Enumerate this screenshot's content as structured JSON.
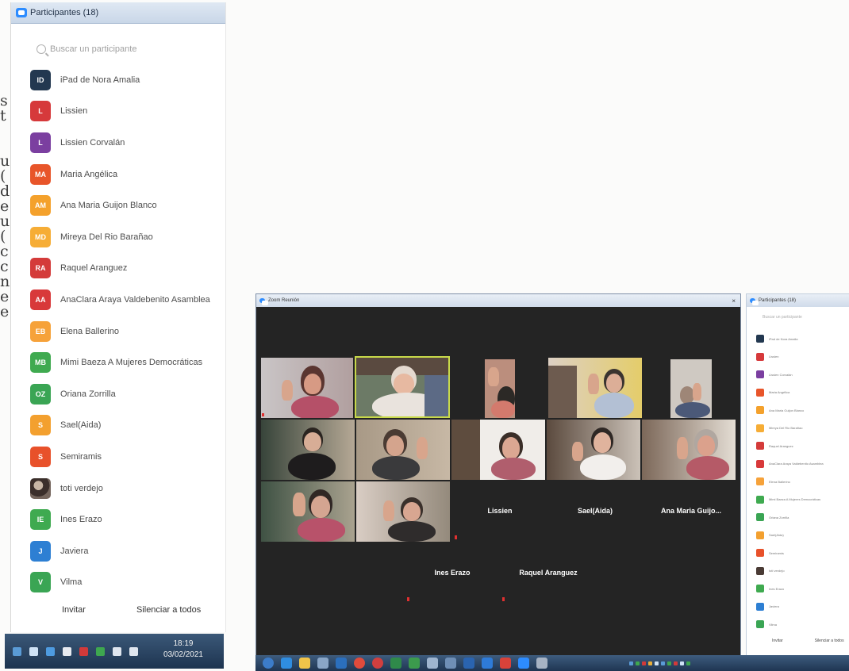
{
  "participants_panel": {
    "title": "Participantes (18)",
    "search_placeholder": "Buscar un participante",
    "participants": [
      {
        "initials": "ID",
        "name": "iPad de Nora Amalia",
        "color": "#233850"
      },
      {
        "initials": "L",
        "name": "Lissien",
        "color": "#d6393b"
      },
      {
        "initials": "L",
        "name": "Lissien Corvalán",
        "color": "#7b3fa0"
      },
      {
        "initials": "MA",
        "name": "Maria Angélica",
        "color": "#e8552a"
      },
      {
        "initials": "AM",
        "name": "Ana Maria Guijon Blanco",
        "color": "#f4a12c"
      },
      {
        "initials": "MD",
        "name": "Mireya Del Rio Barañao",
        "color": "#f6ad36"
      },
      {
        "initials": "RA",
        "name": "Raquel Aranguez",
        "color": "#d43b3a"
      },
      {
        "initials": "AA",
        "name": "AnaClara Araya Valdebenito Asamblea",
        "color": "#d8393a"
      },
      {
        "initials": "EB",
        "name": "Elena Ballerino",
        "color": "#f6a23a"
      },
      {
        "initials": "MB",
        "name": "Mimi Baeza A Mujeres Democráticas",
        "color": "#3faa50"
      },
      {
        "initials": "OZ",
        "name": "Oriana Zorrilla",
        "color": "#3aa554"
      },
      {
        "initials": "S",
        "name": "Sael(Aida)",
        "color": "#f3a02f"
      },
      {
        "initials": "S",
        "name": "Semiramis",
        "color": "#e8512a"
      },
      {
        "initials": "",
        "name": "toti verdejo",
        "color": "photo"
      },
      {
        "initials": "IE",
        "name": "Ines Erazo",
        "color": "#3faa50"
      },
      {
        "initials": "J",
        "name": "Javiera",
        "color": "#2d7fd3"
      },
      {
        "initials": "V",
        "name": "Vilma",
        "color": "#3aa554"
      }
    ],
    "invite_label": "Invitar",
    "mute_all_label": "Silenciar a todos"
  },
  "taskbar_left": {
    "time": "18:19",
    "date": "03/02/2021"
  },
  "meeting": {
    "window_title": "Zoom Reunión",
    "name_tiles": [
      "Lissien",
      "Sael(Aida)",
      "Ana Maria Guijo...",
      "Ines Erazo",
      "Raquel Aranguez"
    ]
  },
  "colors": {
    "taskbar": "#1f3552",
    "meeting_bg": "#242424",
    "zoom_blue": "#2d8cff"
  }
}
